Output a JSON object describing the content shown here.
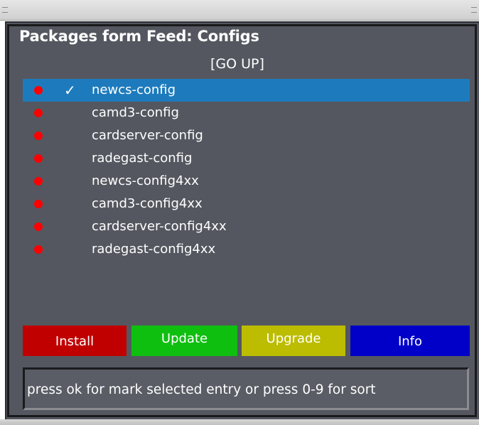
{
  "window": {
    "title": "Packages form Feed: Configs"
  },
  "navigation": {
    "go_up": "[GO UP]"
  },
  "packages": [
    {
      "name": "newcs-config",
      "status": "red",
      "checked": true,
      "selected": true
    },
    {
      "name": "camd3-config",
      "status": "red",
      "checked": false,
      "selected": false
    },
    {
      "name": "cardserver-config",
      "status": "red",
      "checked": false,
      "selected": false
    },
    {
      "name": "radegast-config",
      "status": "red",
      "checked": false,
      "selected": false
    },
    {
      "name": "newcs-config4xx",
      "status": "red",
      "checked": false,
      "selected": false
    },
    {
      "name": "camd3-config4xx",
      "status": "red",
      "checked": false,
      "selected": false
    },
    {
      "name": "cardserver-config4xx",
      "status": "red",
      "checked": false,
      "selected": false
    },
    {
      "name": "radegast-config4xx",
      "status": "red",
      "checked": false,
      "selected": false
    }
  ],
  "check_glyph": "✓",
  "buttons": {
    "red": {
      "label": "Install",
      "color": "#c00000"
    },
    "green": {
      "label": "Update",
      "color": "#0fbf10"
    },
    "yellow": {
      "label": "Upgrade",
      "color": "#bcbc00"
    },
    "blue": {
      "label": "Info",
      "color": "#0000c8"
    }
  },
  "status": {
    "text": "press ok for mark selected entry or press 0-9 for sort"
  },
  "colors": {
    "background": "#54575f",
    "selection": "#1d7bbd",
    "status_dot": "#ff0000"
  }
}
